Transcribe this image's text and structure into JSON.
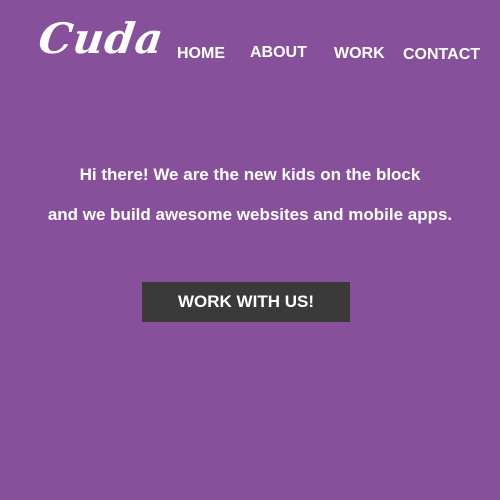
{
  "header": {
    "logo": "Cuda",
    "nav": {
      "home": "HOME",
      "about": "ABOUT",
      "work": "WORK",
      "contact": "CONTACT"
    }
  },
  "hero": {
    "line1": "Hi there! We are the new kids on the block",
    "line2": "and we build awesome websites and mobile apps.",
    "cta_label": "WORK WITH US!"
  },
  "colors": {
    "background": "#87509b",
    "button": "#3a3a3a",
    "text": "#ffffff"
  }
}
